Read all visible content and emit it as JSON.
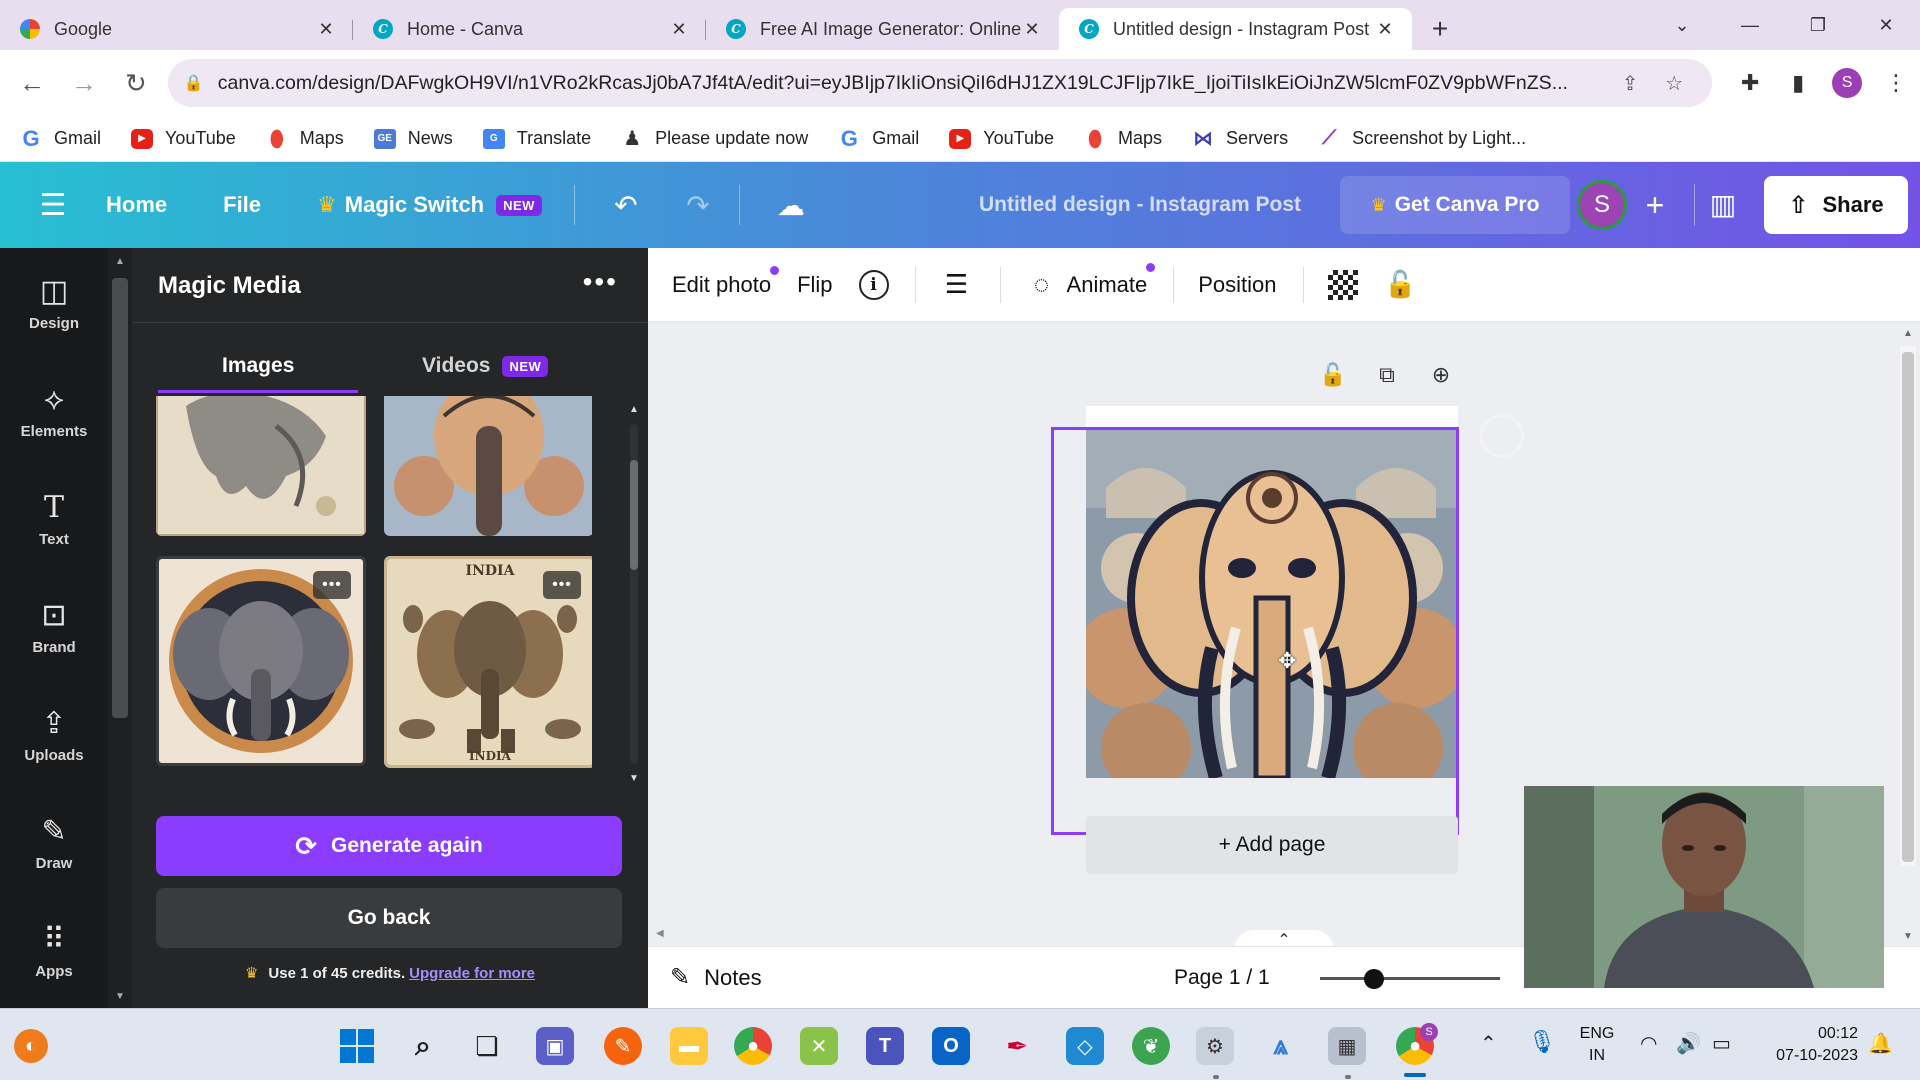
{
  "browser": {
    "tabs": [
      {
        "title": "Google",
        "icon": "google-favicon"
      },
      {
        "title": "Home - Canva",
        "icon": "canva-favicon"
      },
      {
        "title": "Free AI Image Generator: Online",
        "icon": "canva-favicon"
      },
      {
        "title": "Untitled design - Instagram Post",
        "icon": "canva-favicon",
        "active": true
      }
    ],
    "url": "canva.com/design/DAFwgkOH9VI/n1VRo2kRcasJj0bA7Jf4tA/edit?ui=eyJBIjp7IkIiOnsiQiI6dHJ1ZX19LCJFIjp7IkE_IjoiTiIsIkEiOiJnZW5lcmF0ZV9pbWFnZS...",
    "profile_initial": "S",
    "bookmarks": [
      "Gmail",
      "YouTube",
      "Maps",
      "News",
      "Translate",
      "Please update now",
      "Gmail",
      "YouTube",
      "Maps",
      "Servers",
      "Screenshot by Light..."
    ]
  },
  "header": {
    "home": "Home",
    "file": "File",
    "magic_switch": "Magic Switch",
    "new_badge": "NEW",
    "design_title": "Untitled design - Instagram Post",
    "get_pro": "Get Canva Pro",
    "avatar_initial": "S",
    "share": "Share"
  },
  "rail": [
    {
      "label": "Design",
      "icon": "design-icon"
    },
    {
      "label": "Elements",
      "icon": "elements-icon"
    },
    {
      "label": "Text",
      "icon": "text-icon"
    },
    {
      "label": "Brand",
      "icon": "brand-icon"
    },
    {
      "label": "Uploads",
      "icon": "uploads-icon"
    },
    {
      "label": "Draw",
      "icon": "draw-icon"
    },
    {
      "label": "Apps",
      "icon": "apps-icon"
    }
  ],
  "panel": {
    "title": "Magic Media",
    "tabs": {
      "images": "Images",
      "videos": "Videos",
      "videos_badge": "NEW"
    },
    "thumb_text": {
      "india_top": "INDIA",
      "india_bottom": "INDIA"
    },
    "generate_again": "Generate again",
    "go_back": "Go back",
    "credits_text": "Use 1 of 45 credits.",
    "upgrade_link": "Upgrade for more"
  },
  "toolbar": {
    "edit_photo": "Edit photo",
    "flip": "Flip",
    "animate": "Animate",
    "position": "Position"
  },
  "canvas": {
    "add_page": "+ Add page"
  },
  "footer": {
    "notes": "Notes",
    "page_indicator": "Page 1 / 1",
    "zoom_fraction": 0.3
  },
  "taskbar": {
    "language": "ENG",
    "region": "IN",
    "time": "00:12",
    "date": "07-10-2023",
    "chrome_badge": "S"
  },
  "colors": {
    "canva_purple": "#8b3dff",
    "header_gradient_start": "#27bfd2",
    "header_gradient_end": "#7353e6",
    "panel_bg": "#252627",
    "rail_bg": "#18191b"
  }
}
